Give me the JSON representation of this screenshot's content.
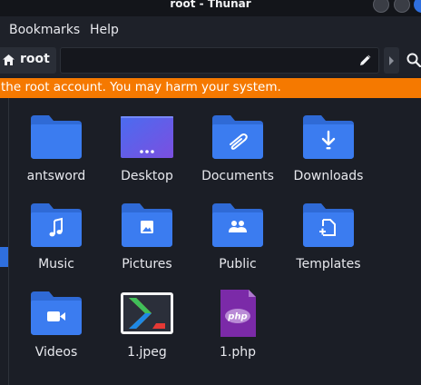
{
  "window": {
    "title": "root - Thunar"
  },
  "menubar": {
    "items": [
      {
        "label": "Bookmarks"
      },
      {
        "label": "Help"
      }
    ]
  },
  "location": {
    "current": "root",
    "entry_value": ""
  },
  "warning": {
    "text": "the root account. You may harm your system."
  },
  "colors": {
    "folder_blue": "#3b7cf0",
    "folder_blue_dark": "#2f6ad6",
    "warning_orange": "#f57900",
    "accent": "#2f6fde",
    "background": "#1b1e26"
  },
  "items": [
    {
      "label": "antsword",
      "icon": "folder-icon"
    },
    {
      "label": "Desktop",
      "icon": "desktop-folder-icon"
    },
    {
      "label": "Documents",
      "icon": "documents-folder-icon"
    },
    {
      "label": "Downloads",
      "icon": "downloads-folder-icon"
    },
    {
      "label": "Music",
      "icon": "music-folder-icon"
    },
    {
      "label": "Pictures",
      "icon": "pictures-folder-icon"
    },
    {
      "label": "Public",
      "icon": "public-folder-icon"
    },
    {
      "label": "Templates",
      "icon": "templates-folder-icon"
    },
    {
      "label": "Videos",
      "icon": "videos-folder-icon"
    },
    {
      "label": "1.jpeg",
      "icon": "image-file-icon"
    },
    {
      "label": "1.php",
      "icon": "php-file-icon",
      "badge": "php"
    }
  ]
}
